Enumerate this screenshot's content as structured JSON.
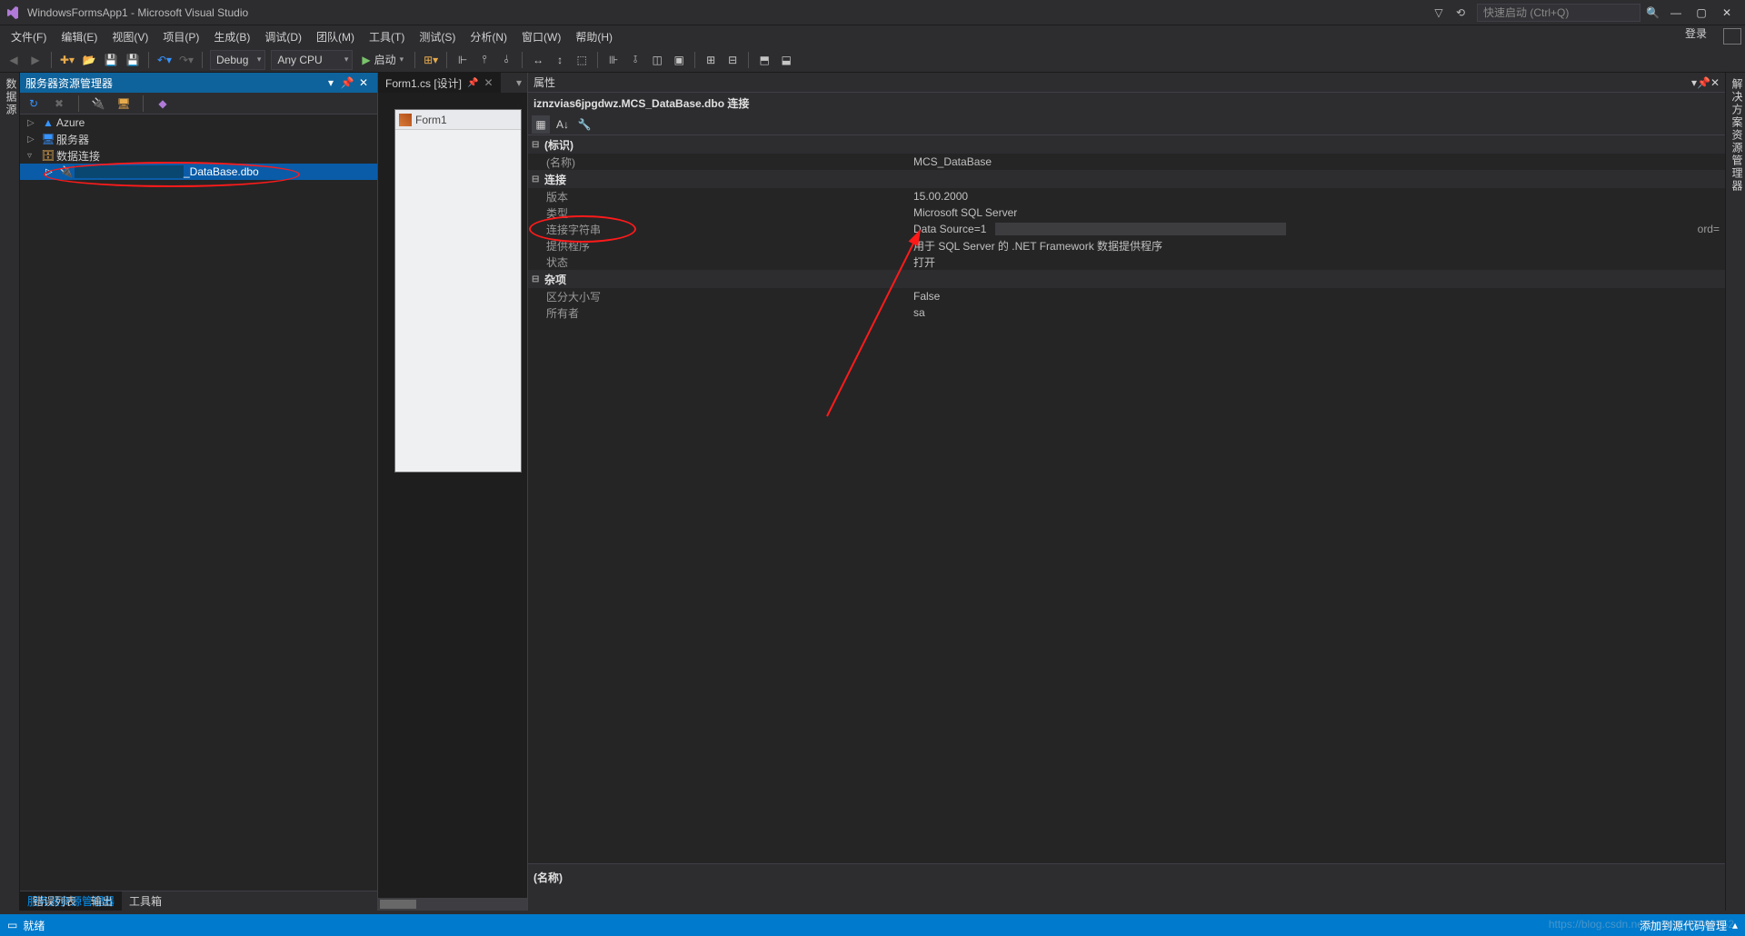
{
  "titlebar": {
    "title": "WindowsFormsApp1 - Microsoft Visual Studio",
    "quick_launch_placeholder": "快速启动 (Ctrl+Q)"
  },
  "menu": {
    "items": [
      "文件(F)",
      "编辑(E)",
      "视图(V)",
      "项目(P)",
      "生成(B)",
      "调试(D)",
      "团队(M)",
      "工具(T)",
      "测试(S)",
      "分析(N)",
      "窗口(W)",
      "帮助(H)"
    ],
    "login": "登录"
  },
  "toolbar": {
    "config": "Debug",
    "platform": "Any CPU",
    "start": "启动"
  },
  "left_rail": "数据源",
  "server_explorer": {
    "title": "服务器资源管理器",
    "nodes": {
      "azure": "Azure",
      "servers": "服务器",
      "data_conn": "数据连接",
      "selected_suffix": "_DataBase.dbo"
    },
    "tabs": {
      "active": "服务器资源管理器",
      "other": "工具箱"
    }
  },
  "doc_tab": {
    "label": "Form1.cs [设计]"
  },
  "form_preview": {
    "caption": "Form1"
  },
  "properties": {
    "panel_title": "属性",
    "object": "iznzvias6jpgdwz.MCS_DataBase.dbo 连接",
    "cats": {
      "identity": "(标识)",
      "connection": "连接",
      "misc": "杂项"
    },
    "rows": {
      "name_label": "(名称)",
      "name_value": "MCS_DataBase",
      "version_label": "版本",
      "version_value": "15.00.2000",
      "type_label": "类型",
      "type_value": "Microsoft SQL Server",
      "connstr_label": "连接字符串",
      "connstr_value": "Data Source=1",
      "connstr_ext": "ord=",
      "provider_label": "提供程序",
      "provider_value": "用于 SQL Server 的 .NET Framework 数据提供程序",
      "state_label": "状态",
      "state_value": "打开",
      "case_label": "区分大小写",
      "case_value": "False",
      "owner_label": "所有者",
      "owner_value": "sa"
    },
    "desc_name": "(名称)"
  },
  "right_rail": "解决方案资源管理器",
  "bottom": {
    "errors": "错误列表",
    "output": "输出"
  },
  "status": {
    "ready": "就绪",
    "scm": "添加到源代码管理",
    "watermark": "https://blog.csdn.net/weixin_43469752"
  }
}
